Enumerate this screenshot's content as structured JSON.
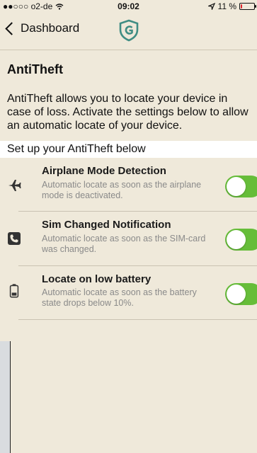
{
  "statusbar": {
    "carrier": "●●○○○ o2-de",
    "time": "09:02",
    "battery": "11 %",
    "battery_level": 0.11
  },
  "nav": {
    "back_label": "Dashboard",
    "logo_icon": "shield-logo-icon"
  },
  "page": {
    "title": "AntiTheft",
    "description": "AntiTheft allows you to locate your device in case of loss. Activate the settings below to allow an automatic locate of your device.",
    "section_header": "Set up your AntiTheft below"
  },
  "settings": [
    {
      "icon": "airplane-icon",
      "title": "Airplane Mode Detection",
      "subtitle": "Automatic locate as soon as the airplane mode is deactivated.",
      "enabled": true
    },
    {
      "icon": "phone-icon",
      "title": "Sim Changed Notification",
      "subtitle": "Automatic locate as soon as the SIM-card was changed.",
      "enabled": true
    },
    {
      "icon": "battery-low-icon",
      "title": "Locate on low battery",
      "subtitle": "Automatic locate as soon as the battery state drops below 10%.",
      "enabled": true
    }
  ],
  "colors": {
    "background": "#efe9da",
    "toggle_on": "#66bd39",
    "battery_low": "#e0262c"
  }
}
